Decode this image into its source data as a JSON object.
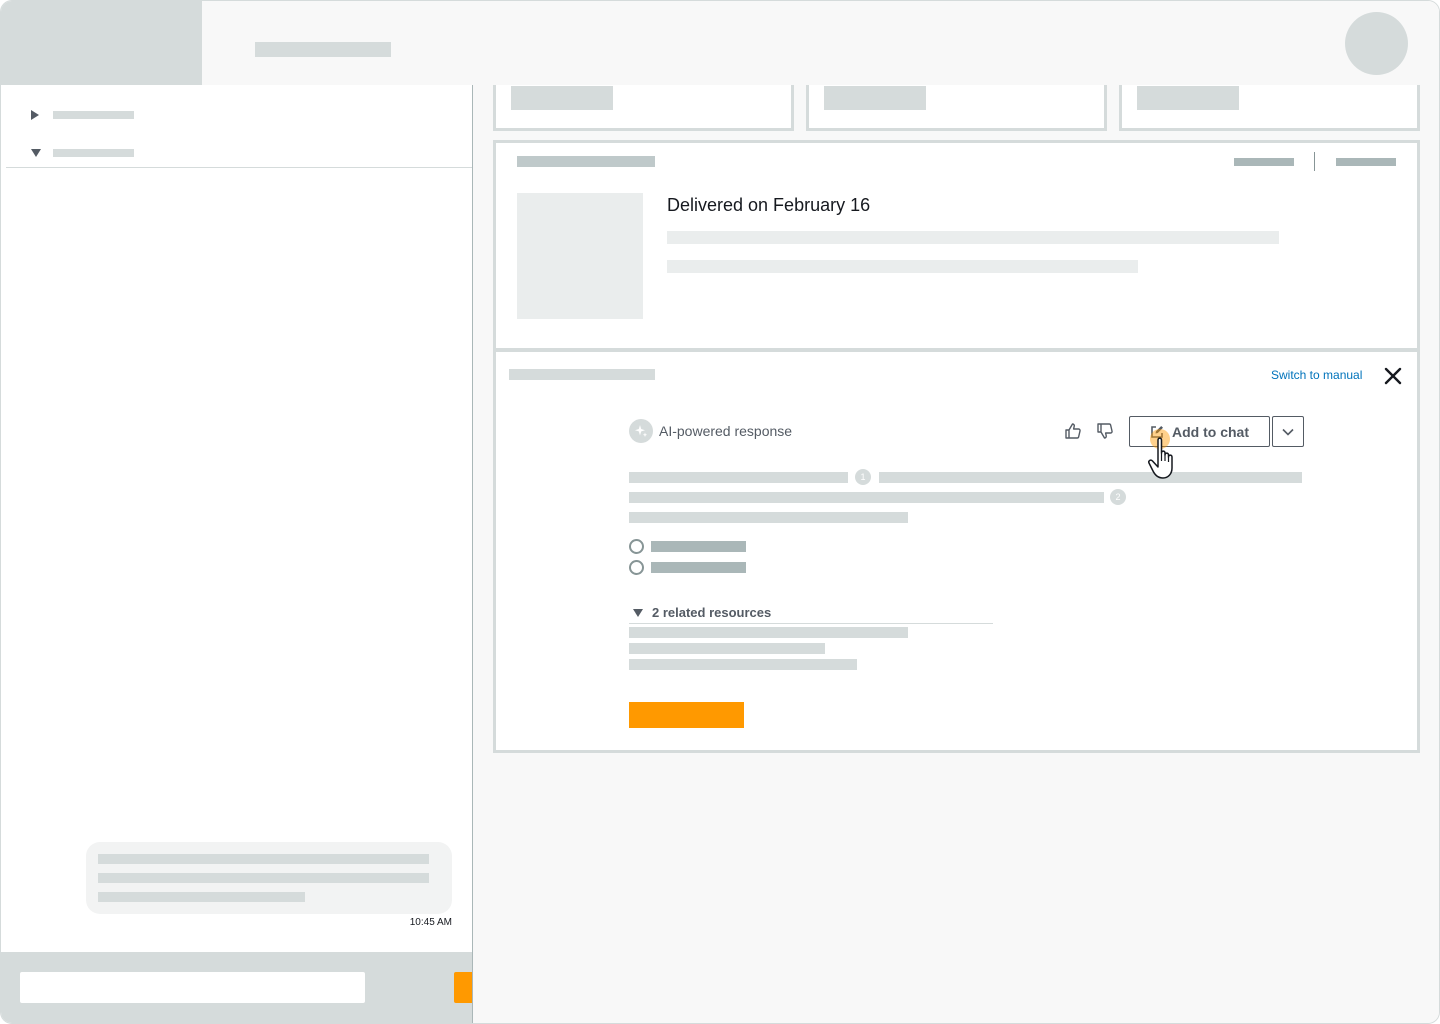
{
  "window": {
    "title": ""
  },
  "order": {
    "status_text": "Delivered on February 16"
  },
  "assistant": {
    "switch_label": "Switch to manual",
    "ai_label": "AI-powered response",
    "add_to_chat_label": "Add to chat",
    "citations": [
      "1",
      "2"
    ],
    "related_resources_label": "2 related resources"
  },
  "chat": {
    "timestamp": "10:45 AM"
  },
  "colors": {
    "accent": "#ff9900",
    "link": "#0073bb",
    "placeholder": "#d5dbdb"
  },
  "icons": {
    "ai": "sparkle-icon",
    "thumb_up": "thumbs-up-icon",
    "thumb_down": "thumbs-down-icon",
    "add_to_chat": "edit-icon",
    "dropdown": "chevron-down-icon",
    "close": "close-icon"
  }
}
